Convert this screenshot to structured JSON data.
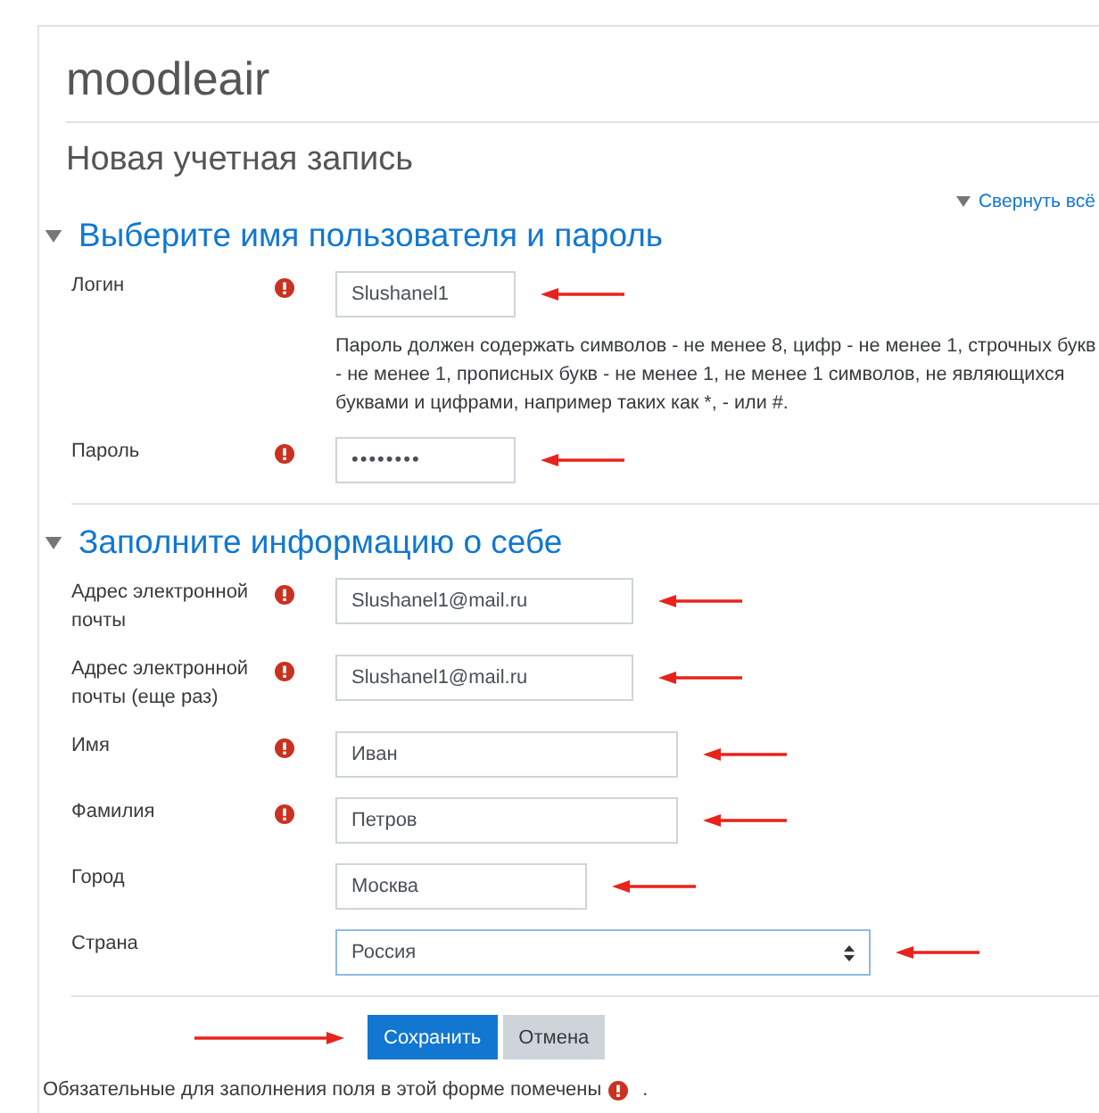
{
  "site_title": "moodleair",
  "page_heading": "Новая учетная запись",
  "collapse_all": "Свернуть всё",
  "sections": [
    {
      "title": "Выберите имя пользователя и пароль",
      "expanded": true,
      "fields": [
        {
          "kind": "text",
          "label": "Логин",
          "required": true,
          "value": "Slushanel1",
          "annotated": true
        },
        {
          "kind": "note",
          "text": "Пароль должен содержать символов - не менее 8, цифр - не менее 1, строчных букв\n- не менее 1, прописных букв - не менее 1, не менее 1 символов, не являющихся\nбуквами и цифрами, например таких как *, - или #."
        },
        {
          "kind": "password",
          "label": "Пароль",
          "required": true,
          "value": "••••••••",
          "annotated": true
        }
      ]
    },
    {
      "title": "Заполните информацию о себе",
      "expanded": true,
      "fields": [
        {
          "kind": "text",
          "label": "Адрес электронной почты",
          "required": true,
          "value": "Slushanel1@mail.ru",
          "annotated": true
        },
        {
          "kind": "text",
          "label": "Адрес электронной почты (еще раз)",
          "required": true,
          "value": "Slushanel1@mail.ru",
          "annotated": true
        },
        {
          "kind": "text",
          "label": "Имя",
          "required": true,
          "value": "Иван",
          "annotated": true
        },
        {
          "kind": "text",
          "label": "Фамилия",
          "required": true,
          "value": "Петров",
          "annotated": true
        },
        {
          "kind": "text",
          "label": "Город",
          "required": false,
          "value": "Москва",
          "annotated": true
        },
        {
          "kind": "select",
          "label": "Страна",
          "required": false,
          "value": "Россия",
          "annotated": true
        }
      ]
    }
  ],
  "buttons": [
    {
      "kind": "primary",
      "label": "Сохранить",
      "annotated": true
    },
    {
      "kind": "secondary",
      "label": "Отмена"
    }
  ],
  "footer_note": "Обязательные для заполнения поля в этой форме помечены",
  "footer_end": "."
}
